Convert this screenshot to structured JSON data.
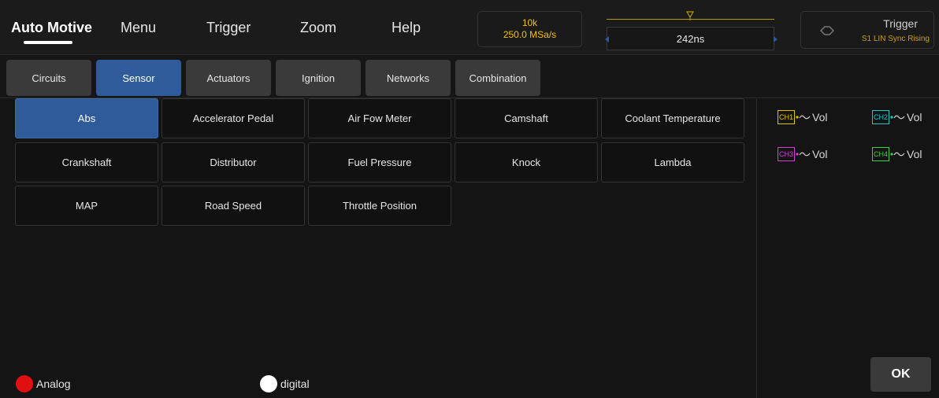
{
  "topbar": {
    "items": [
      {
        "label": "Auto Motive"
      },
      {
        "label": "Menu"
      },
      {
        "label": "Trigger"
      },
      {
        "label": "Zoom"
      },
      {
        "label": "Help"
      }
    ],
    "sample_points": "10k",
    "sample_rate": "250.0 MSa/s",
    "timebase": "242ns",
    "trigger_title": "Trigger",
    "trigger_sub": "S1 LIN Sync Rising"
  },
  "tabs": [
    "Circuits",
    "Sensor",
    "Actuators",
    "Ignition",
    "Networks",
    "Combination"
  ],
  "sensors": [
    "Abs",
    "Accelerator Pedal",
    "Air Fow Meter",
    "Camshaft",
    "Coolant Temperature",
    "Crankshaft",
    "Distributor",
    "Fuel Pressure",
    "Knock",
    "Lambda",
    "MAP",
    "Road Speed",
    "Throttle Position"
  ],
  "channels": [
    {
      "id": "CH1",
      "unit": "Vol",
      "color": "#e0c400"
    },
    {
      "id": "CH2",
      "unit": "Vol",
      "color": "#1fc7c7"
    },
    {
      "id": "CH3",
      "unit": "Vol",
      "color": "#d640d6"
    },
    {
      "id": "CH4",
      "unit": "Vol",
      "color": "#3fcf3f"
    }
  ],
  "ok_label": "OK",
  "modes": [
    {
      "label": "Analog",
      "color": "#e01010"
    },
    {
      "label": "digital",
      "color": "#ffffff"
    }
  ],
  "colors": {
    "accent": "#2f5b9a",
    "rate_text": "#f2c200"
  }
}
